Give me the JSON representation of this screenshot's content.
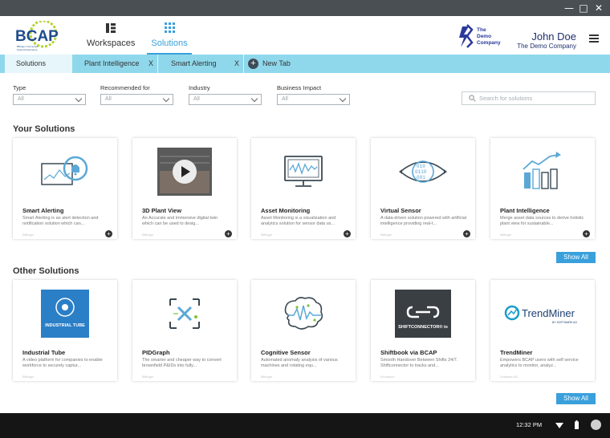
{
  "window": {
    "controls": [
      "—",
      "□",
      "✕"
    ]
  },
  "header": {
    "logo": {
      "text": "BCAP",
      "subtitle": "Bilfinger Connected Asset Performance"
    },
    "nav": [
      {
        "label": "Workspaces",
        "icon": "workspaces-icon"
      },
      {
        "label": "Solutions",
        "icon": "grid-icon"
      }
    ],
    "company_logo": "The Demo Company",
    "user": {
      "name": "John Doe",
      "company": "The Demo Company"
    }
  },
  "tabs": [
    {
      "label": "Solutions",
      "closable": false
    },
    {
      "label": "Plant Intelligence",
      "close": "X"
    },
    {
      "label": "Smart Alerting",
      "close": "X"
    },
    {
      "label": "New Tab",
      "icon": "plus-icon"
    }
  ],
  "filters": [
    {
      "label": "Type",
      "value": "All"
    },
    {
      "label": "Recommended for",
      "value": "All"
    },
    {
      "label": "Industry",
      "value": "All"
    },
    {
      "label": "Business Impact",
      "value": "All"
    }
  ],
  "search": {
    "placeholder": "Search for solutions"
  },
  "your_solutions": {
    "title": "Your Solutions",
    "show_all": "Show All",
    "cards": [
      {
        "title": "Smart Alerting",
        "desc": "Smart Alerting is an alert detection and notification solution which can...",
        "meta": "Bilfinger",
        "icon": "alert-monitor-icon"
      },
      {
        "title": "3D Plant View",
        "desc": "An Accurate and immersive digital twin which can be used to desig...",
        "meta": "Bilfinger",
        "icon": "video-play-icon"
      },
      {
        "title": "Asset Monitoring",
        "desc": "Asset Monitoring is a visualization and analytics solution for sensor data us...",
        "meta": "Bilfinger",
        "icon": "monitor-chart-icon"
      },
      {
        "title": "Virtual Sensor",
        "desc": "A data-driven solution powered with artificial intelligence providing real-t...",
        "meta": "Bilfinger",
        "icon": "binary-eye-icon"
      },
      {
        "title": "Plant Intelligence",
        "desc": "Merge asset data sources to derive holistic plant view for sustainable...",
        "meta": "Bilfinger",
        "icon": "growth-chart-icon"
      }
    ]
  },
  "other_solutions": {
    "title": "Other Solutions",
    "show_all": "Show All",
    "cards": [
      {
        "title": "Industrial Tube",
        "desc": "A video platform for companies to enable workforce to securely captur...",
        "meta": "Bilfinger",
        "icon": "industrial-tube-icon",
        "logo_text": "INDUSTRIAL TUBE"
      },
      {
        "title": "PIDGraph",
        "desc": "The smarter and cheaper way to convert brownfield P&IDs into fully...",
        "meta": "Bilfinger",
        "icon": "pidgraph-icon"
      },
      {
        "title": "Cognitive Sensor",
        "desc": "Automated anomaly analysis of various machines and rotating equ...",
        "meta": "Bilfinger",
        "icon": "brain-icon"
      },
      {
        "title": "Shiftbook via BCAP",
        "desc": "Smooth Handover Between Shifts 24/7. Shiftconnector to tracks and...",
        "meta": "Eschbach",
        "icon": "shiftconnector-icon",
        "logo_text": "SHIFTCONNECTOR® io"
      },
      {
        "title": "TrendMiner",
        "desc": "Empowers BCAP users with self service analytics to monitor, analyz...",
        "meta": "Software AG",
        "icon": "trendminer-icon",
        "logo_text": "TrendMiner",
        "logo_sub": "BY SOFTWARE AG"
      }
    ]
  },
  "taskbar": {
    "time": "12:32 PM"
  }
}
